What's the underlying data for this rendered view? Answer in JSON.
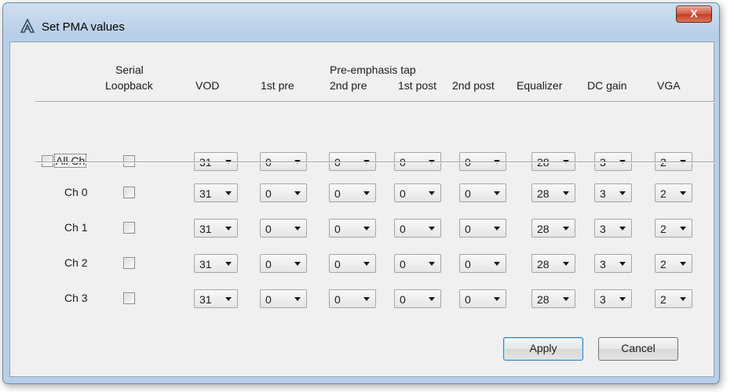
{
  "window": {
    "title": "Set PMA values",
    "close_symbol": "X"
  },
  "headers": {
    "serial_loopback_line1": "Serial",
    "serial_loopback_line2": "Loopback",
    "vod": "VOD",
    "pre_emphasis_tap": "Pre-emphasis tap",
    "first_pre": "1st pre",
    "second_pre": "2nd pre",
    "first_post": "1st post",
    "second_post": "2nd post",
    "equalizer": "Equalizer",
    "dc_gain": "DC gain",
    "vga": "VGA"
  },
  "all_channels": {
    "label": "All Ch",
    "checked": false,
    "loopback": false,
    "vod": "31",
    "first_pre": "0",
    "second_pre": "0",
    "first_post": "0",
    "second_post": "0",
    "equalizer": "28",
    "dc_gain": "3",
    "vga": "2"
  },
  "channels": [
    {
      "label": "Ch 0",
      "loopback": false,
      "vod": "31",
      "first_pre": "0",
      "second_pre": "0",
      "first_post": "0",
      "second_post": "0",
      "equalizer": "28",
      "dc_gain": "3",
      "vga": "2"
    },
    {
      "label": "Ch 1",
      "loopback": false,
      "vod": "31",
      "first_pre": "0",
      "second_pre": "0",
      "first_post": "0",
      "second_post": "0",
      "equalizer": "28",
      "dc_gain": "3",
      "vga": "2"
    },
    {
      "label": "Ch 2",
      "loopback": false,
      "vod": "31",
      "first_pre": "0",
      "second_pre": "0",
      "first_post": "0",
      "second_post": "0",
      "equalizer": "28",
      "dc_gain": "3",
      "vga": "2"
    },
    {
      "label": "Ch 3",
      "loopback": false,
      "vod": "31",
      "first_pre": "0",
      "second_pre": "0",
      "first_post": "0",
      "second_post": "0",
      "equalizer": "28",
      "dc_gain": "3",
      "vga": "2"
    }
  ],
  "buttons": {
    "apply": "Apply",
    "cancel": "Cancel"
  },
  "icons": {
    "title_icon": "altera-logo-icon",
    "dropdown_arrow": "chevron-down-icon"
  }
}
